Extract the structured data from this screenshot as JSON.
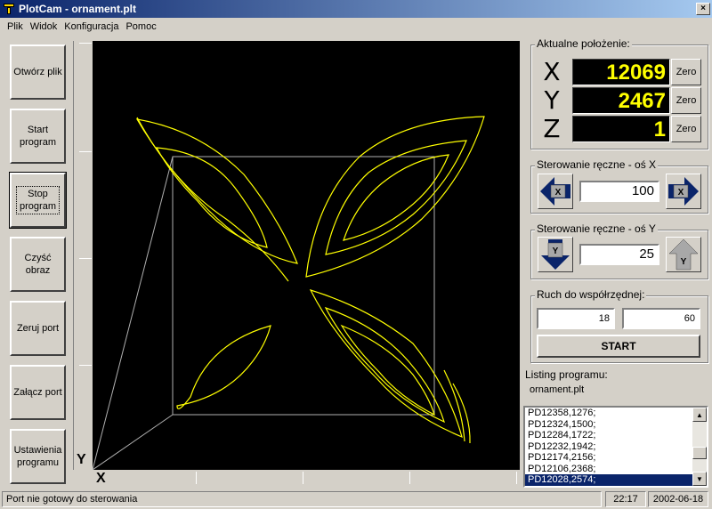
{
  "window": {
    "title": "PlotCam - ornament.plt",
    "minimize": "_",
    "maximize": "□",
    "close": "×"
  },
  "menu": [
    "Plik",
    "Widok",
    "Konfiguracja",
    "Pomoc"
  ],
  "left_buttons": [
    {
      "id": "open-file",
      "label": "Otwórz plik"
    },
    {
      "id": "start-program",
      "label": "Start\nprogram"
    },
    {
      "id": "stop-program",
      "label": "Stop\nprogram"
    },
    {
      "id": "clear-image",
      "label": "Czyść\nobraz"
    },
    {
      "id": "reset-port",
      "label": "Zeruj port"
    },
    {
      "id": "enable-port",
      "label": "Załącz port"
    },
    {
      "id": "program-settings",
      "label": "Ustawienia\nprogramu"
    }
  ],
  "plot": {
    "axis_y": "Y",
    "axis_x": "X"
  },
  "position": {
    "title": "Aktualne położenie:",
    "x_label": "X",
    "x_value": "12069",
    "y_label": "Y",
    "y_value": "2467",
    "z_label": "Z",
    "z_value": "1",
    "zero_label": "Zero"
  },
  "manual_x": {
    "title": "Sterowanie ręczne - oś X",
    "value": "100",
    "btn_label": "X"
  },
  "manual_y": {
    "title": "Sterowanie ręczne - oś Y",
    "value": "25",
    "btn_label": "Y"
  },
  "move_to": {
    "title": "Ruch do współrzędnej:",
    "x_value": "18",
    "y_value": "60",
    "start_label": "START"
  },
  "listing": {
    "title": "Listing programu:",
    "filename": "ornament.plt",
    "lines": [
      "PD12358,1276;",
      "PD12324,1500;",
      "PD12284,1722;",
      "PD12232,1942;",
      "PD12174,2156;",
      "PD12106,2368;",
      "PD12028,2574;"
    ],
    "selected_index": 6
  },
  "status": {
    "message": "Port nie gotowy do sterowania",
    "time": "22:17",
    "date": "2002-06-18"
  },
  "colors": {
    "plot_bg": "#000000",
    "plot_stroke": "#ffff00",
    "value_text": "#ffff00",
    "title_bar": "#0a246a",
    "arrow_blue": "#0a246a",
    "arrow_gray": "#a8a8a8"
  }
}
